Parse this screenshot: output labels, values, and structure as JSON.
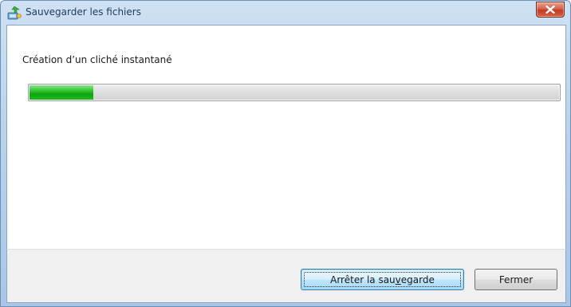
{
  "window": {
    "title": "Sauvegarder les fichiers",
    "app_icon": "backup-icon",
    "close_icon": "close-icon"
  },
  "main": {
    "status_text": "Création d’un cliché instantané",
    "progress": {
      "value": 0.12
    }
  },
  "footer": {
    "stop_button": {
      "before": "Arrêter la sau",
      "mnemonic": "v",
      "after": "egarde"
    },
    "close_button": {
      "label": "Fermer"
    }
  },
  "colors": {
    "progress_fill": "#1fba1f",
    "titlebar": "#bcd3ec",
    "close_button": "#c23a24",
    "default_button_border": "#3c7fb1"
  }
}
